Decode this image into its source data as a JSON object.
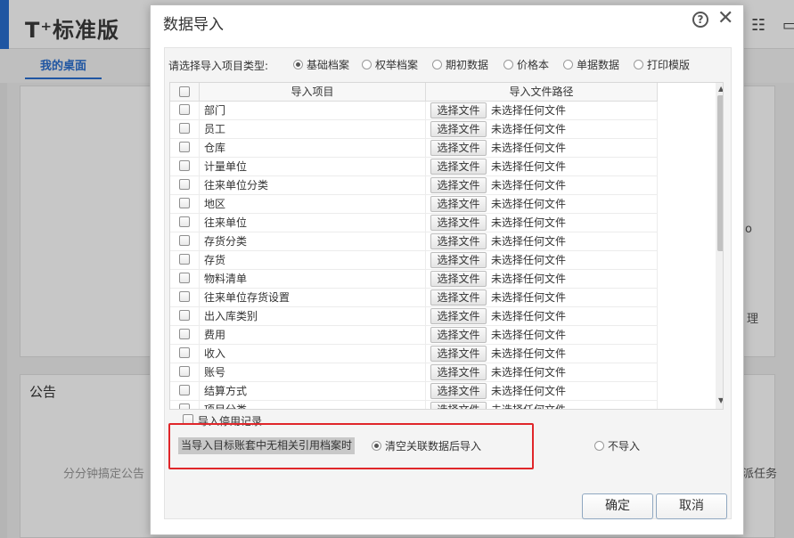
{
  "app": {
    "logo": "T⁺标准版",
    "tab_desktop": "我的桌面",
    "panel_notice_title": "公告",
    "panel_notice_sub": "分分钟搞定公告",
    "right_text_1": "理",
    "right_text_2": "指派任务",
    "right_text_3": "o"
  },
  "dialog": {
    "title": "数据导入",
    "help_label": "?",
    "close_label": "✕",
    "type_prompt": "请选择导入项目类型:",
    "type_options": [
      {
        "label": "基础档案",
        "selected": true
      },
      {
        "label": "权举档案",
        "selected": false
      },
      {
        "label": "期初数据",
        "selected": false
      },
      {
        "label": "价格本",
        "selected": false
      },
      {
        "label": "单据数据",
        "selected": false
      },
      {
        "label": "打印模版",
        "selected": false
      }
    ],
    "columns": {
      "item": "导入项目",
      "path": "导入文件路径"
    },
    "rows": [
      {
        "name": "部门",
        "button": "选择文件",
        "status": "未选择任何文件"
      },
      {
        "name": "员工",
        "button": "选择文件",
        "status": "未选择任何文件"
      },
      {
        "name": "仓库",
        "button": "选择文件",
        "status": "未选择任何文件"
      },
      {
        "name": "计量单位",
        "button": "选择文件",
        "status": "未选择任何文件"
      },
      {
        "name": "往来单位分类",
        "button": "选择文件",
        "status": "未选择任何文件"
      },
      {
        "name": "地区",
        "button": "选择文件",
        "status": "未选择任何文件"
      },
      {
        "name": "往来单位",
        "button": "选择文件",
        "status": "未选择任何文件"
      },
      {
        "name": "存货分类",
        "button": "选择文件",
        "status": "未选择任何文件"
      },
      {
        "name": "存货",
        "button": "选择文件",
        "status": "未选择任何文件"
      },
      {
        "name": "物料清单",
        "button": "选择文件",
        "status": "未选择任何文件"
      },
      {
        "name": "往来单位存货设置",
        "button": "选择文件",
        "status": "未选择任何文件"
      },
      {
        "name": "出入库类别",
        "button": "选择文件",
        "status": "未选择任何文件"
      },
      {
        "name": "费用",
        "button": "选择文件",
        "status": "未选择任何文件"
      },
      {
        "name": "收入",
        "button": "选择文件",
        "status": "未选择任何文件"
      },
      {
        "name": "账号",
        "button": "选择文件",
        "status": "未选择任何文件"
      },
      {
        "name": "结算方式",
        "button": "选择文件",
        "status": "未选择任何文件"
      },
      {
        "name": "项目分类",
        "button": "选择文件",
        "status": "未选择任何文件"
      }
    ],
    "import_disabled_label": "导入停用记录",
    "policy_label": "当导入目标账套中无相关引用档案时",
    "policy_options": [
      {
        "label": "清空关联数据后导入",
        "selected": true
      },
      {
        "label": "不导入",
        "selected": false
      }
    ],
    "ok_label": "确定",
    "cancel_label": "取消",
    "highlight_color": "#e0262a"
  }
}
